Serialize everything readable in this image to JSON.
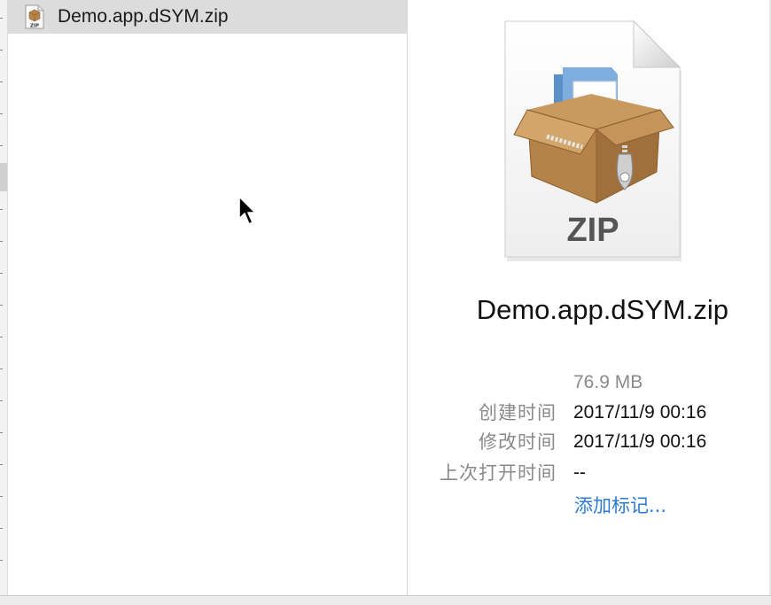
{
  "file_list": {
    "items": [
      {
        "name": "Demo.app.dSYM.zip",
        "icon": "zip-archive-icon",
        "selected": true
      }
    ]
  },
  "preview": {
    "icon": "zip-archive-icon",
    "icon_badge": "ZIP",
    "file_name": "Demo.app.dSYM.zip",
    "info": {
      "size": "76.9 MB",
      "created_label": "创建时间",
      "created_value": "2017/11/9 00:16",
      "modified_label": "修改时间",
      "modified_value": "2017/11/9 00:16",
      "last_opened_label": "上次打开时间",
      "last_opened_value": "--"
    },
    "add_tags_link": "添加标记..."
  },
  "colors": {
    "selection": "#dcdcdc",
    "link": "#2b7ad6",
    "label": "#8a8a8a"
  }
}
